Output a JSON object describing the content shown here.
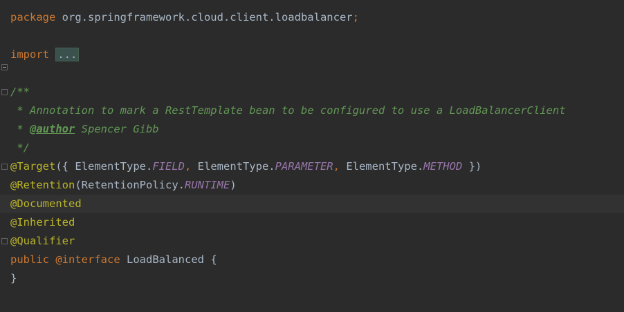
{
  "editor": {
    "line1": {
      "kw": "package",
      "pkg": "org.springframework.cloud.client.loadbalancer",
      "semi": ";"
    },
    "line2": {
      "kw": "import",
      "fold": "..."
    },
    "line3": {
      "comment": "/**"
    },
    "line4": {
      "comment": " * Annotation to mark a RestTemplate bean to be configured to use a LoadBalancerClient"
    },
    "line5": {
      "prefix": " * ",
      "tag": "@author",
      "rest": " Spencer Gibb"
    },
    "line6": {
      "comment": " */"
    },
    "line7": {
      "ann": "@Target",
      "open": "({ ",
      "t1": "ElementType.",
      "f1": "FIELD",
      "c1": ", ",
      "t2": "ElementType.",
      "f2": "PARAMETER",
      "c2": ", ",
      "t3": "ElementType.",
      "f3": "METHOD",
      "close": " })"
    },
    "line8": {
      "ann": "@Retention",
      "open": "(",
      "t1": "RetentionPolicy.",
      "f1": "RUNTIME",
      "close": ")"
    },
    "line9": {
      "ann": "@Documented"
    },
    "line10": {
      "ann": "@Inherited"
    },
    "line11": {
      "ann": "@Qualifier"
    },
    "line12": {
      "kw": "public",
      "kw2": "@interface",
      "name": "LoadBalanced",
      "brace": "{"
    },
    "line13": {
      "brace": "}"
    }
  }
}
